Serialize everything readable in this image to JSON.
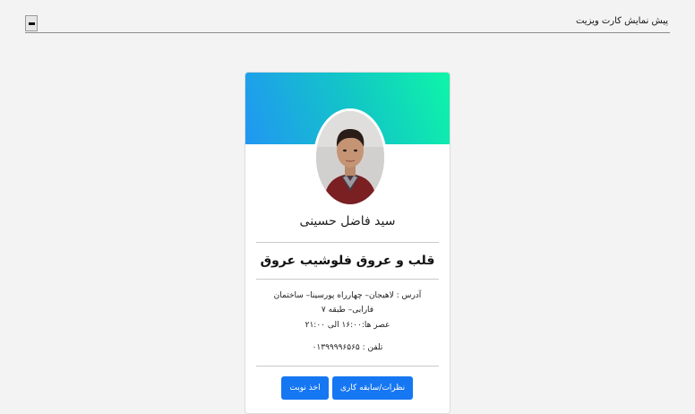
{
  "toolbar": {
    "title": "پیش نمایش کارت ویزیت",
    "collapse_icon": "minus-icon"
  },
  "card": {
    "colors": {
      "gradient_start": "#2196f3",
      "gradient_end": "#0ef5a8",
      "button": "#1677f2"
    },
    "name": "سید فاضل حسینی",
    "specialty": "قلب و عروق فلوشیب عروق",
    "address_line1": "آدرس : لاهیجان– چهارراه پورسینا– ساختمان",
    "address_line2": "فارابی– طبقه ۷",
    "hours": "عصر ها:۱۶:۰۰ الی ۲۱:۰۰",
    "phone": "تلفن : ۰۱۳۹۹۹۹۶۵۶۵",
    "buttons": {
      "history": "نظرات/سابقه کاری",
      "appointment": "اخذ نوبت"
    }
  }
}
